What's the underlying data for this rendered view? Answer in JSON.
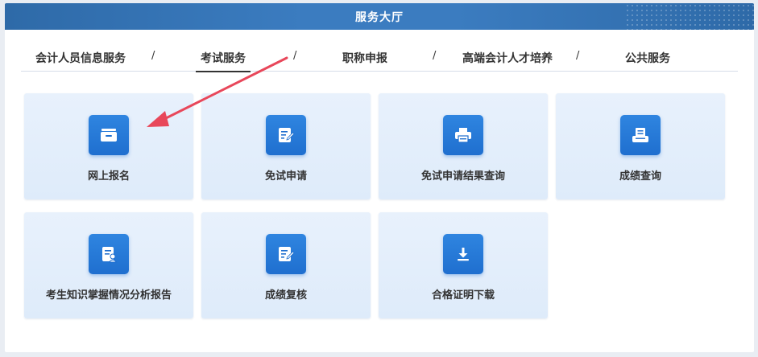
{
  "header": {
    "title": "服务大厅"
  },
  "tabs": [
    {
      "label": "会计人员信息服务"
    },
    {
      "label": "考试服务"
    },
    {
      "label": "职称申报"
    },
    {
      "label": "高端会计人才培养"
    },
    {
      "label": "公共服务"
    }
  ],
  "tab_separator": "/",
  "active_tab": "考试服务",
  "cards": [
    {
      "label": "网上报名",
      "icon": "drawer-icon"
    },
    {
      "label": "免试申请",
      "icon": "edit-document-icon"
    },
    {
      "label": "免试申请结果查询",
      "icon": "printer-icon"
    },
    {
      "label": "成绩查询",
      "icon": "printout-icon"
    },
    {
      "label": "考生知识掌握情况分析报告",
      "icon": "report-user-icon"
    },
    {
      "label": "成绩复核",
      "icon": "edit-document-icon"
    },
    {
      "label": "合格证明下载",
      "icon": "download-icon"
    }
  ],
  "colors": {
    "header_bg": "#3b7cc0",
    "icon_bg": "#1f6fcf",
    "card_bg": "#e3eefb",
    "arrow": "#e8475a"
  }
}
